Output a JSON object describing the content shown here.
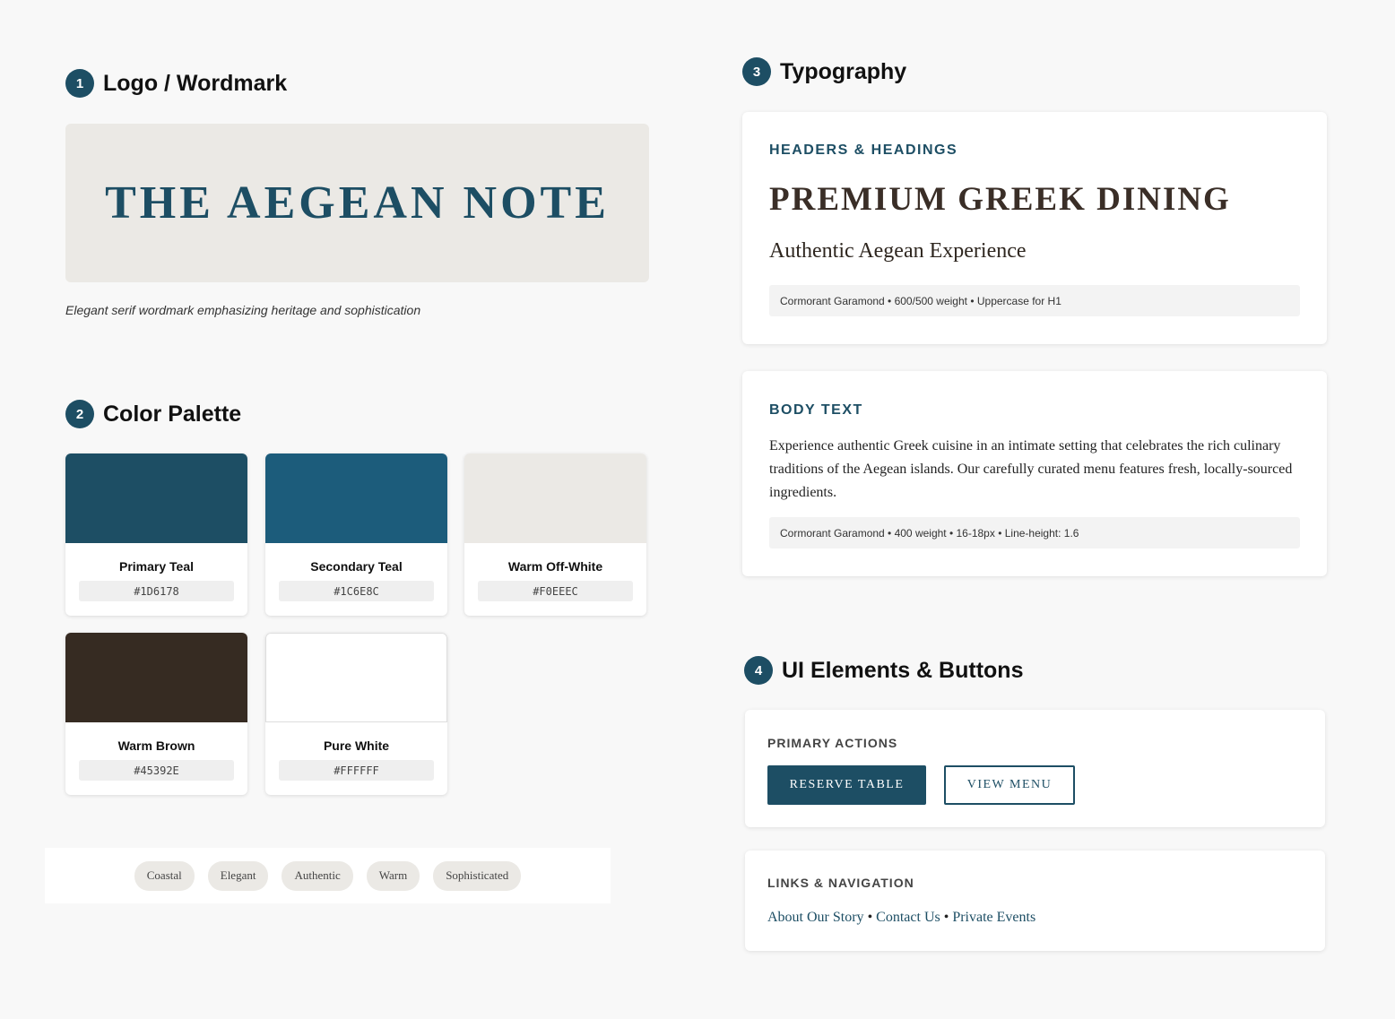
{
  "sections": {
    "logo": {
      "number": "1",
      "title": "Logo / Wordmark"
    },
    "palette": {
      "number": "2",
      "title": "Color Palette"
    },
    "typography": {
      "number": "3",
      "title": "Typography"
    },
    "ui": {
      "number": "4",
      "title": "UI Elements & Buttons"
    }
  },
  "logo": {
    "wordmark": "THE AEGEAN NOTE",
    "caption": "Elegant serif wordmark emphasizing heritage and sophistication"
  },
  "palette": {
    "colors": [
      {
        "name": "Primary Teal",
        "hex": "#1D6178",
        "swatch": "#1d4e64"
      },
      {
        "name": "Secondary Teal",
        "hex": "#1C6E8C",
        "swatch": "#1c5c7b"
      },
      {
        "name": "Warm Off-White",
        "hex": "#F0EEEC",
        "swatch": "#ebe9e5"
      },
      {
        "name": "Warm Brown",
        "hex": "#45392E",
        "swatch": "#362b22"
      },
      {
        "name": "Pure White",
        "hex": "#FFFFFF",
        "swatch": "#ffffff"
      }
    ],
    "tags": [
      "Coastal",
      "Elegant",
      "Authentic",
      "Warm",
      "Sophisticated"
    ]
  },
  "typography": {
    "headers": {
      "label": "HEADERS & HEADINGS",
      "h1": "PREMIUM GREEK DINING",
      "h2": "Authentic Aegean Experience",
      "spec": "Cormorant Garamond • 600/500 weight • Uppercase for H1"
    },
    "body": {
      "label": "BODY TEXT",
      "sample": "Experience authentic Greek cuisine in an intimate setting that celebrates the rich culinary traditions of the Aegean islands. Our carefully curated menu features fresh, locally-sourced ingredients.",
      "spec": "Cormorant Garamond • 400 weight • 16-18px • Line-height: 1.6"
    }
  },
  "ui": {
    "primary_actions": {
      "label": "PRIMARY ACTIONS",
      "primary_button": "RESERVE TABLE",
      "secondary_button": "VIEW MENU"
    },
    "links": {
      "label": "LINKS & NAVIGATION",
      "items": [
        "About Our Story",
        "Contact Us",
        "Private Events"
      ],
      "separator": "•"
    }
  }
}
